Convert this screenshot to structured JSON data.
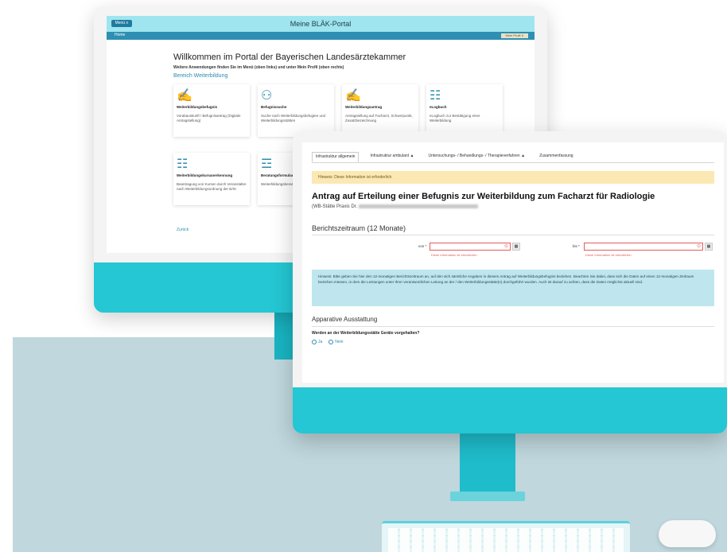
{
  "back_screen": {
    "menu_label": "Menü ≡",
    "title": "Meine BLÄK-Portal",
    "nav_home": "Home",
    "nav_profile": "Mein Profil ∨",
    "welcome": "Willkommen im Portal der Bayerischen Landesärztekammer",
    "hint": "Weitere Anwendungen finden Sie im Menü (oben links) und unter Mein Profil (oben rechts)",
    "area_title": "Bereich Weiterbildung",
    "tiles": [
      {
        "title": "Weiterbildungsbefugnis",
        "desc": "Vorabauskunft / Befugnisantrag (Digitale Antragstellung)",
        "icon": "✍"
      },
      {
        "title": "Befugnissuche",
        "desc": "Suche nach Weiterbildungsbefugten und Weiterbildungsstätten",
        "icon": "⚇"
      },
      {
        "title": "Weiterbildungsantrag",
        "desc": "Antragstellung auf Facharzt, Schwerpunkt, Zusatzbezeichnung",
        "icon": "✍"
      },
      {
        "title": "eLogbuch",
        "desc": "eLogbuch zur Bestätigung einer Weiterbildung",
        "icon": "☷"
      },
      {
        "title": "Weiterbildungskursanerkennung",
        "desc": "Beantragung von Kursen durch Veranstalter nach Weiterbildungsordnung der BÄK",
        "icon": "☷"
      },
      {
        "title": "Beratungsformular",
        "desc": "Weiterbildungsberatung gemäß § 11 WO",
        "icon": "☲"
      }
    ],
    "back_link": "Zurück"
  },
  "front_screen": {
    "tabs": [
      {
        "label": "Infrastruktur allgemein",
        "warn": ""
      },
      {
        "label": "Infrastruktur ambulant",
        "warn": "▲"
      },
      {
        "label": "Untersuchungs- / Behandlungs- / Therapieverfahren",
        "warn": "▲"
      },
      {
        "label": "Zusammenfassung",
        "warn": ""
      }
    ],
    "hinweis_top": "Hinweis: Diese Information ist erforderlich.",
    "form_title": "Antrag auf Erteilung einer Befugnis zur Weiterbildung zum Facharzt für Radiologie",
    "form_subtitle": "(WB-Stätte Praxis Dr.",
    "section_period": "Berichtszeitraum (12 Monate)",
    "von_label": "von *",
    "bis_label": "bis *",
    "error_text": "Diese Information ist erforderlich",
    "hinweis_period": "Hinweis: Bitte geben Sie hier den 12-monatigen Berichtszeitraum an, auf den sich sämtliche Angaben in diesem Antrag auf Weiterbildungsbefugnis beziehen. Beachten Sie dabei, dass sich die Daten auf einen 12-monatigen Zeitraum beziehen müssen, in dem die Leistungen unter Ihrer verantwortlichen Leitung an der / den Weiterbildungsstätte(n) durchgeführt wurden. Auch ist darauf zu achten, dass die Daten möglichst aktuell sind.",
    "section_equipment": "Apparative Ausstattung",
    "question": "Werden an der Weiterbildungsstätte Geräte vorgehalten?",
    "radio_yes": "Ja",
    "radio_no": "Nein"
  },
  "colors": {
    "accent": "#24c7d3",
    "link": "#2a8cab",
    "warning_bg": "#fbe8b3",
    "info_bg": "#bfe6ee",
    "error": "#e25c5c"
  }
}
